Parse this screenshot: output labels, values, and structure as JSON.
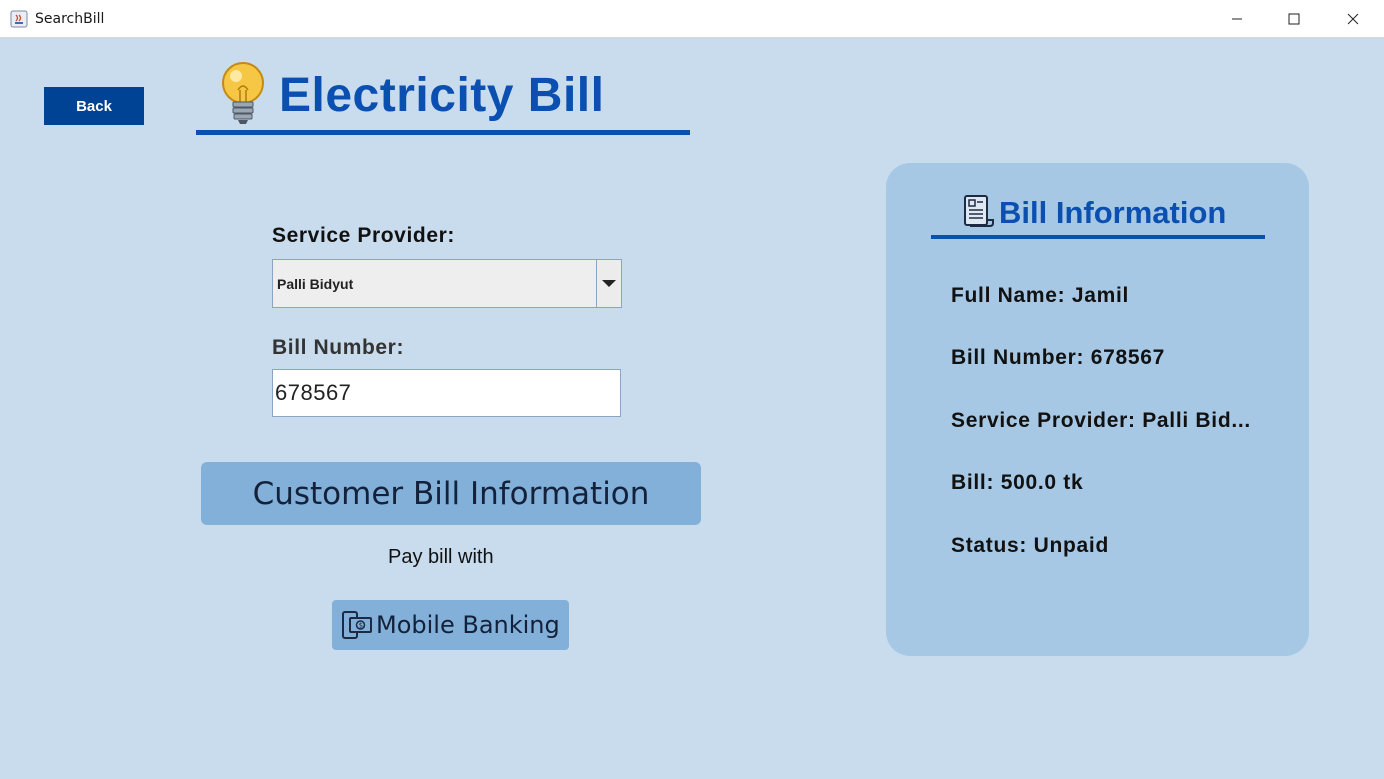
{
  "window": {
    "title": "SearchBill",
    "icons": [
      "java-app-icon",
      "minimize-icon",
      "maximize-icon",
      "close-icon"
    ]
  },
  "header": {
    "back_label": "Back",
    "title": "Electricity Bill",
    "title_icon": "lightbulb-icon",
    "accent_color": "#0b4fb0"
  },
  "form": {
    "provider_label": "Service Provider:",
    "provider_value": "Palli Bidyut",
    "bill_number_label": "Bill Number:",
    "bill_number_value": "678567",
    "submit_label": "Customer Bill Information",
    "pay_with_text": "Pay bill with",
    "mobile_banking_label": "Mobile Banking",
    "mobile_banking_icon": "mobile-money-icon"
  },
  "bill_info": {
    "title": "Bill Information",
    "title_icon": "receipt-icon",
    "full_name": "Full Name: Jamil",
    "bill_number": "Bill Number: 678567",
    "service_provider": "Service Provider: Palli Bid...",
    "bill": "Bill: 500.0 tk",
    "status": "Status: Unpaid"
  },
  "colors": {
    "background": "#c8dcee",
    "panel": "#a6c8e5",
    "button": "#82b0d9",
    "back_button": "#004293"
  }
}
